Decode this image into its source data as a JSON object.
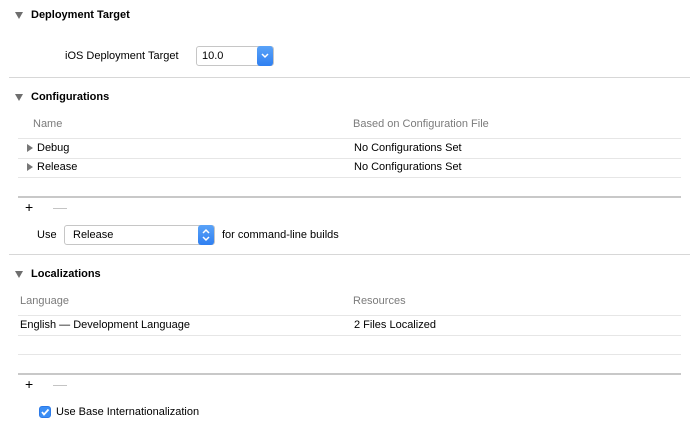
{
  "deployment": {
    "title": "Deployment Target",
    "label": "iOS Deployment Target",
    "value": "10.0"
  },
  "configurations": {
    "title": "Configurations",
    "headers": {
      "name": "Name",
      "based_on": "Based on Configuration File"
    },
    "rows": [
      {
        "name": "Debug",
        "based_on": "No Configurations Set"
      },
      {
        "name": "Release",
        "based_on": "No Configurations Set"
      }
    ],
    "plus": "+",
    "minus": "—",
    "use_label": "Use",
    "use_value": "Release",
    "use_suffix": "for command-line builds"
  },
  "localizations": {
    "title": "Localizations",
    "headers": {
      "language": "Language",
      "resources": "Resources"
    },
    "rows": [
      {
        "language": "English — Development Language",
        "resources": "2 Files Localized"
      }
    ],
    "plus": "+",
    "minus": "—",
    "base_i18n": {
      "label": "Use Base Internationalization",
      "checked": true
    }
  },
  "colors": {
    "accent": "#2f7ff1",
    "header_text": "#7b7b7b",
    "separator": "#d7d7d7"
  }
}
